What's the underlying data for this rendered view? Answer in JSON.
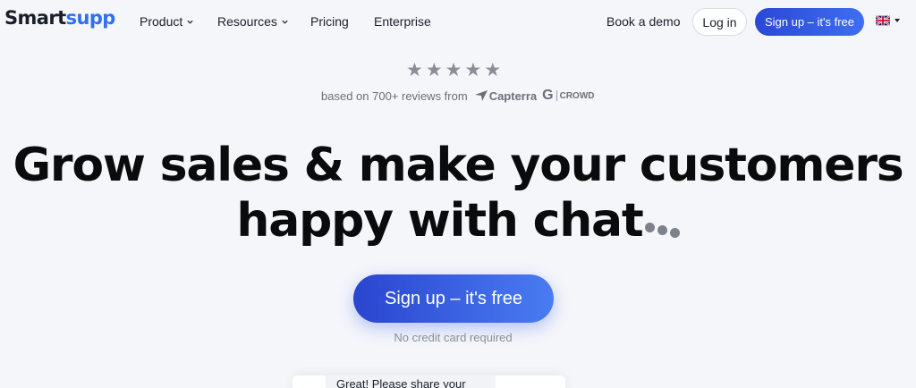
{
  "nav": {
    "logo_part1": "Smart",
    "logo_part2": "supp",
    "links": [
      {
        "label": "Product",
        "has_dropdown": true
      },
      {
        "label": "Resources",
        "has_dropdown": true
      },
      {
        "label": "Pricing",
        "has_dropdown": false
      },
      {
        "label": "Enterprise",
        "has_dropdown": false
      }
    ],
    "book_demo": "Book a demo",
    "login": "Log in",
    "signup": "Sign up – it's free",
    "language_icon": "uk-flag-icon"
  },
  "rating": {
    "stars": 5,
    "reviews_text": "based on 700+ reviews from",
    "capterra": "Capterra",
    "g2": "G",
    "crowd": "CROWD"
  },
  "hero": {
    "title_line1": "Grow sales & make your customers",
    "title_line2": "happy with chat",
    "cta": "Sign up – it's free",
    "subtext": "No credit card required"
  },
  "preview": {
    "message": "Great! Please share your"
  },
  "colors": {
    "accent": "#3f6ef0",
    "background": "#f5f6fa",
    "text": "#0a0b0d"
  }
}
